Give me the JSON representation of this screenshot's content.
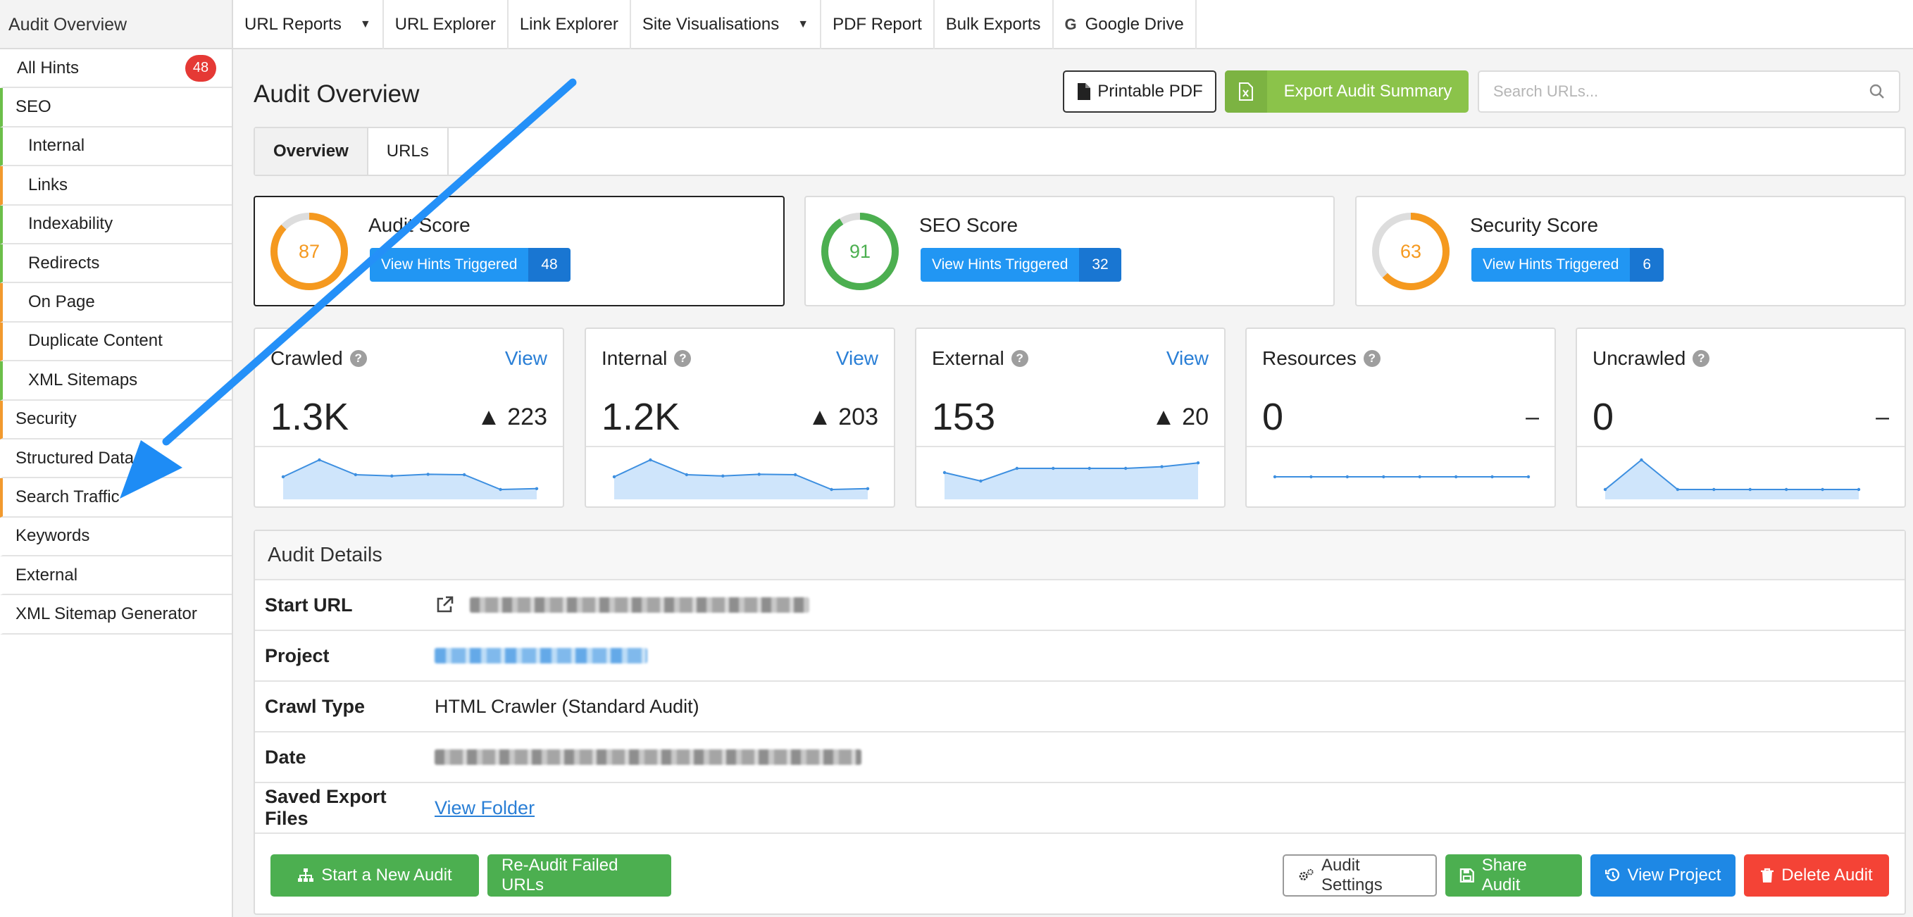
{
  "sidebar": {
    "title": "Audit Overview",
    "all_hints": {
      "label": "All Hints",
      "badge": "48"
    },
    "items": [
      {
        "label": "SEO"
      },
      {
        "label": "Internal"
      },
      {
        "label": "Links"
      },
      {
        "label": "Indexability"
      },
      {
        "label": "Redirects"
      },
      {
        "label": "On Page"
      },
      {
        "label": "Duplicate Content"
      },
      {
        "label": "XML Sitemaps"
      },
      {
        "label": "Security"
      },
      {
        "label": "Structured Data"
      },
      {
        "label": "Search Traffic"
      },
      {
        "label": "Keywords"
      },
      {
        "label": "External"
      },
      {
        "label": "XML Sitemap Generator"
      }
    ]
  },
  "topnav": [
    {
      "label": "URL Reports"
    },
    {
      "label": "URL Explorer"
    },
    {
      "label": "Link Explorer"
    },
    {
      "label": "Site Visualisations"
    },
    {
      "label": "PDF Report"
    },
    {
      "label": "Bulk Exports"
    },
    {
      "label": "Google Drive"
    }
  ],
  "header": {
    "title": "Audit Overview",
    "printable_pdf": "Printable PDF",
    "export_summary": "Export Audit Summary",
    "search_placeholder": "Search URLs..."
  },
  "tabs": [
    {
      "label": "Overview"
    },
    {
      "label": "URLs"
    }
  ],
  "scores": [
    {
      "title": "Audit Score",
      "value": "87",
      "fraction": 0.87,
      "color": "#f5991f",
      "hints_label": "View Hints Triggered",
      "hints_count": "48"
    },
    {
      "title": "SEO Score",
      "value": "91",
      "fraction": 0.91,
      "color": "#4caf50",
      "hints_label": "View Hints Triggered",
      "hints_count": "32"
    },
    {
      "title": "Security Score",
      "value": "63",
      "fraction": 0.63,
      "color": "#f5991f",
      "hints_label": "View Hints Triggered",
      "hints_count": "6"
    }
  ],
  "stats": [
    {
      "title": "Crawled",
      "view": "View",
      "value": "1.3K",
      "delta": "▲ 223",
      "spark": [
        4,
        8,
        4.5,
        4.2,
        4.6,
        4.5,
        1,
        1.2
      ],
      "filled": true
    },
    {
      "title": "Internal",
      "view": "View",
      "value": "1.2K",
      "delta": "▲ 203",
      "spark": [
        4,
        8,
        4.5,
        4.2,
        4.6,
        4.5,
        1,
        1.2
      ],
      "filled": true
    },
    {
      "title": "External",
      "view": "View",
      "value": "153",
      "delta": "▲ 20",
      "spark": [
        5,
        3,
        6,
        6,
        6,
        6,
        6.4,
        7.3
      ],
      "filled": true
    },
    {
      "title": "Resources",
      "view": "",
      "value": "0",
      "delta": "–",
      "spark": [
        4,
        4,
        4,
        4,
        4,
        4,
        4,
        4
      ],
      "filled": false
    },
    {
      "title": "Uncrawled",
      "view": "",
      "value": "0",
      "delta": "–",
      "spark": [
        1,
        8,
        1,
        1,
        1,
        1,
        1,
        1
      ],
      "filled": true
    }
  ],
  "details": {
    "heading": "Audit Details",
    "start_url_label": "Start URL",
    "project_label": "Project",
    "crawl_type_label": "Crawl Type",
    "crawl_type_value": "HTML Crawler (Standard Audit)",
    "date_label": "Date",
    "saved_label": "Saved Export Files",
    "saved_value": "View Folder"
  },
  "actions": {
    "new_audit": "Start a New Audit",
    "reaudit": "Re-Audit Failed URLs",
    "settings": "Audit Settings",
    "share": "Share Audit",
    "view_project": "View Project",
    "delete": "Delete Audit"
  },
  "colors": {
    "accent_blue": "#2196f3",
    "green": "#4caf50",
    "orange": "#f5991f",
    "red": "#f44336",
    "annotation_arrow": "#1e90ff"
  }
}
